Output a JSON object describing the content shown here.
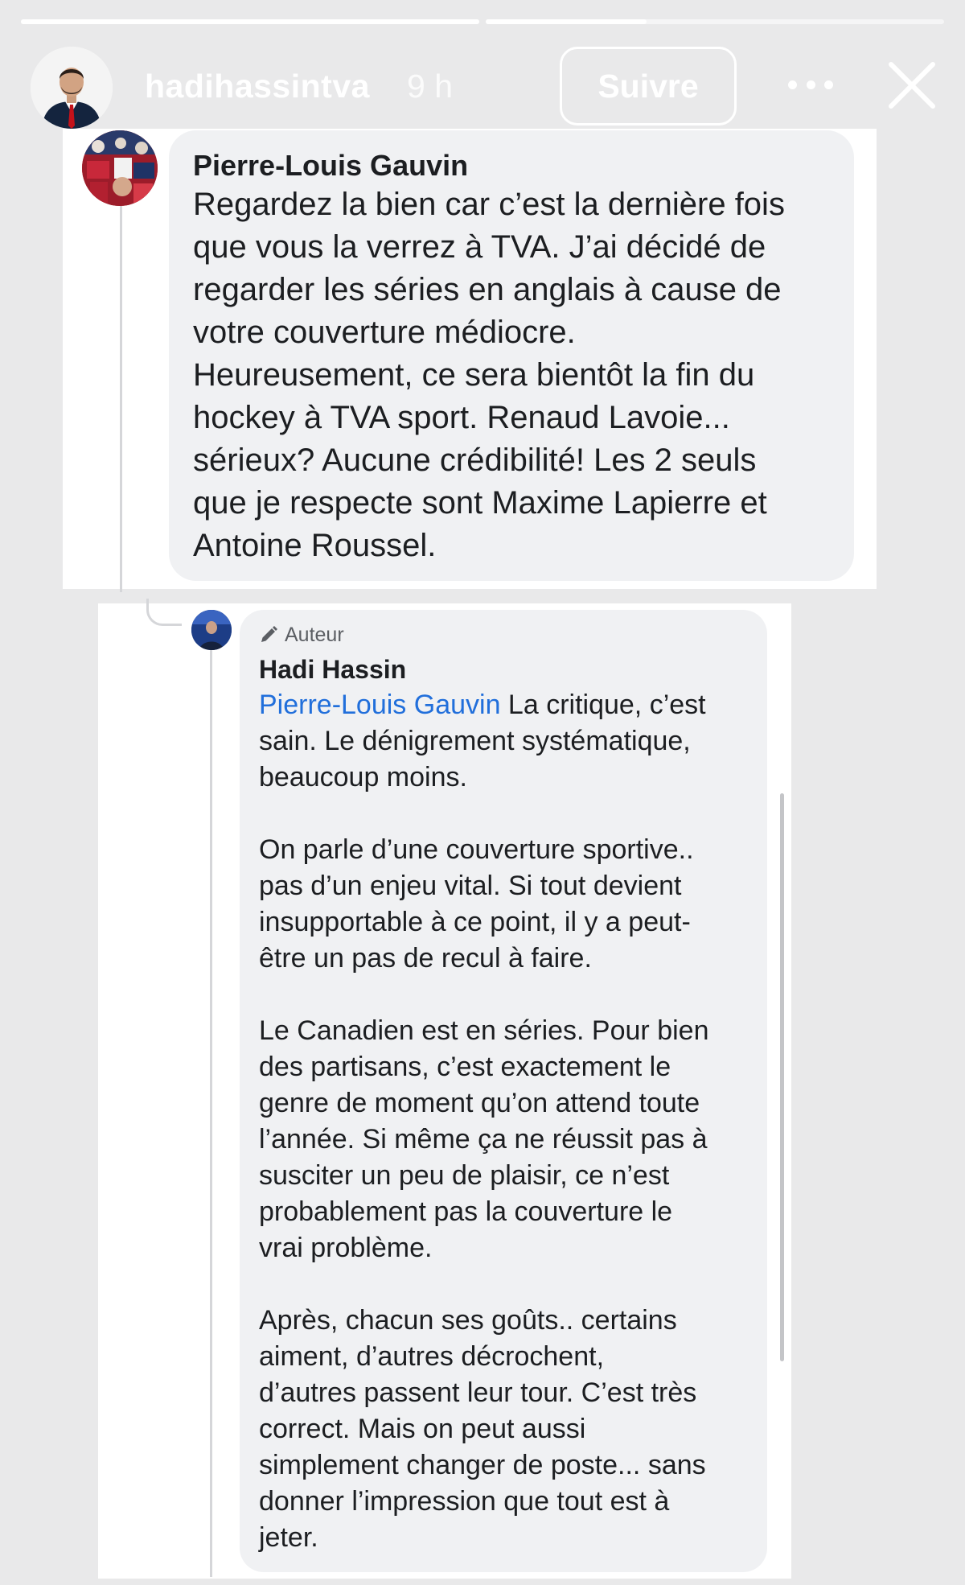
{
  "story": {
    "progress": [
      1.0,
      0.35
    ],
    "username": "hadihassintva",
    "time": "9 h",
    "follow_label": "Suivre",
    "icons": [
      "more-icon",
      "close-icon"
    ]
  },
  "comment": {
    "author": "Pierre-Louis Gauvin",
    "text": "Regardez la bien car c’est la dernière fois\nque vous la verrez à TVA. J’ai décidé de\nregarder les séries en anglais à cause de\nvotre couverture médiocre.\nHeureusement, ce sera bientôt la fin du\nhockey à TVA sport. Renaud Lavoie...\nsérieux? Aucune crédibilité! Les 2 seuls\nque je respecte sont Maxime Lapierre et\nAntoine Roussel."
  },
  "reply": {
    "badge": "Auteur",
    "author": "Hadi Hassin",
    "mention": "Pierre-Louis Gauvin",
    "paragraph1_rest": " La critique, c’est\nsain. Le dénigrement systématique,\nbeaucoup moins.",
    "paragraph2": "On parle d’une couverture sportive..\npas d’un enjeu vital. Si tout devient\ninsupportable à ce point, il y a peut-\nêtre un pas de recul à faire.",
    "paragraph3": "Le Canadien est en séries. Pour bien\ndes partisans, c’est exactement le\ngenre de moment qu’on attend toute\nl’année. Si même ça ne réussit pas à\nsusciter un peu de plaisir, ce n’est\nprobablement pas la couverture le\nvrai problème.",
    "paragraph4": "Après, chacun ses goûts.. certains\naiment, d’autres décrochent,\nd’autres passent leur tour. C’est très\ncorrect. Mais on peut aussi\nsimplement changer de poste... sans\ndonner l’impression que tout est à\njeter."
  },
  "colors": {
    "mention": "#216fdb",
    "bubble": "#f0f1f3",
    "text": "#1c1e21"
  }
}
